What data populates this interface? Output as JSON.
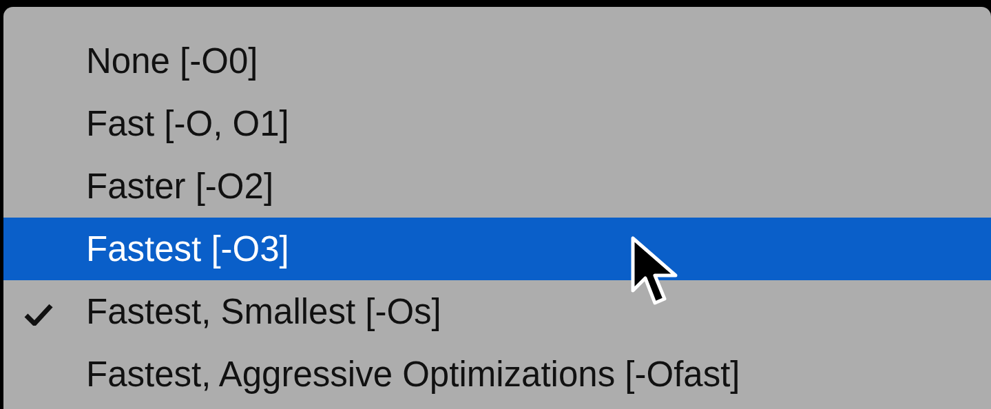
{
  "menu": {
    "items": [
      {
        "label": "None [-O0]",
        "selected": false,
        "checked": false
      },
      {
        "label": "Fast [-O, O1]",
        "selected": false,
        "checked": false
      },
      {
        "label": "Faster [-O2]",
        "selected": false,
        "checked": false
      },
      {
        "label": "Fastest [-O3]",
        "selected": true,
        "checked": false
      },
      {
        "label": "Fastest, Smallest [-Os]",
        "selected": false,
        "checked": true
      },
      {
        "label": "Fastest, Aggressive Optimizations [-Ofast]",
        "selected": false,
        "checked": false
      }
    ]
  }
}
